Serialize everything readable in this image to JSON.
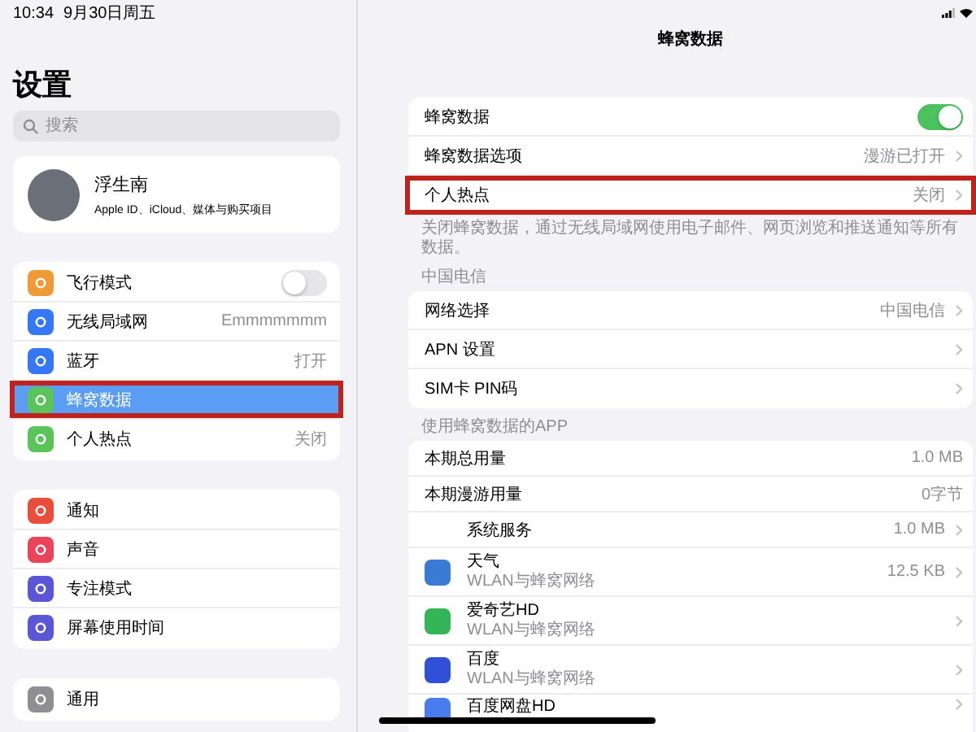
{
  "status_bar": {
    "time": "10:34",
    "date": "9月30日周五"
  },
  "sidebar": {
    "title": "设置",
    "search": {
      "placeholder": "搜索"
    },
    "profile": {
      "name": "浮生南",
      "subtitle": "Apple ID、iCloud、媒体与购买项目"
    },
    "groups": [
      {
        "items": [
          {
            "label": "飞行模式",
            "kind": "toggle",
            "on": false,
            "color": "#f09a37",
            "selected": false,
            "highlighted": false
          },
          {
            "label": "无线局域网",
            "kind": "value",
            "value": "Emmmmmmm",
            "color": "#3478f6",
            "selected": false,
            "highlighted": false
          },
          {
            "label": "蓝牙",
            "kind": "value",
            "value": "打开",
            "color": "#3478f6",
            "selected": false,
            "highlighted": false
          },
          {
            "label": "蜂窝数据",
            "kind": "plain",
            "color": "#5ac35a",
            "selected": true,
            "highlighted": true
          },
          {
            "label": "个人热点",
            "kind": "value",
            "value": "关闭",
            "color": "#5ac35a",
            "selected": false,
            "highlighted": false
          }
        ]
      },
      {
        "items": [
          {
            "label": "通知",
            "kind": "plain",
            "color": "#eb4d3d",
            "selected": false,
            "highlighted": false
          },
          {
            "label": "声音",
            "kind": "plain",
            "color": "#eb445a",
            "selected": false,
            "highlighted": false
          },
          {
            "label": "专注模式",
            "kind": "plain",
            "color": "#5a56d6",
            "selected": false,
            "highlighted": false
          },
          {
            "label": "屏幕使用时间",
            "kind": "plain",
            "color": "#5a56d6",
            "selected": false,
            "highlighted": false
          }
        ]
      },
      {
        "items": [
          {
            "label": "通用",
            "kind": "plain",
            "color": "#8e8e93",
            "selected": false,
            "highlighted": false
          }
        ]
      }
    ]
  },
  "detail": {
    "title": "蜂窝数据",
    "sections": [
      {
        "rows": [
          {
            "label": "蜂窝数据",
            "kind": "toggle",
            "on": true,
            "highlighted": false
          },
          {
            "label": "蜂窝数据选项",
            "kind": "value",
            "value": "漫游已打开",
            "highlighted": false
          },
          {
            "label": "个人热点",
            "kind": "value",
            "value": "关闭",
            "highlighted": true
          }
        ],
        "footer": "关闭蜂窝数据，通过无线局域网使用电子邮件、网页浏览和推送通知等所有数据。"
      },
      {
        "header": "中国电信",
        "rows": [
          {
            "label": "网络选择",
            "kind": "value",
            "value": "中国电信",
            "highlighted": false
          },
          {
            "label": "APN 设置",
            "kind": "value",
            "highlighted": false
          },
          {
            "label": "SIM卡 PIN码",
            "kind": "value",
            "highlighted": false
          }
        ]
      },
      {
        "header": "使用蜂窝数据的APP",
        "rows": [
          {
            "label": "本期总用量",
            "kind": "stat",
            "value": "1.0 MB",
            "highlighted": false
          },
          {
            "label": "本期漫游用量",
            "kind": "stat",
            "value": "0字节",
            "highlighted": false
          },
          {
            "label": "系统服务",
            "kind": "indent",
            "value": "1.0 MB",
            "highlighted": false
          },
          {
            "label": "天气",
            "kind": "app",
            "subtitle": "WLAN与蜂窝网络",
            "value": "12.5 KB",
            "color": "#3a7bd5",
            "highlighted": false
          },
          {
            "label": "爱奇艺HD",
            "kind": "app",
            "subtitle": "WLAN与蜂窝网络",
            "color": "#35b558",
            "highlighted": false
          },
          {
            "label": "百度",
            "kind": "app",
            "subtitle": "WLAN与蜂窝网络",
            "color": "#3050d8",
            "highlighted": false
          },
          {
            "label": "百度网盘HD",
            "kind": "app",
            "color": "#4a7cf0",
            "highlighted": false
          }
        ]
      }
    ]
  }
}
